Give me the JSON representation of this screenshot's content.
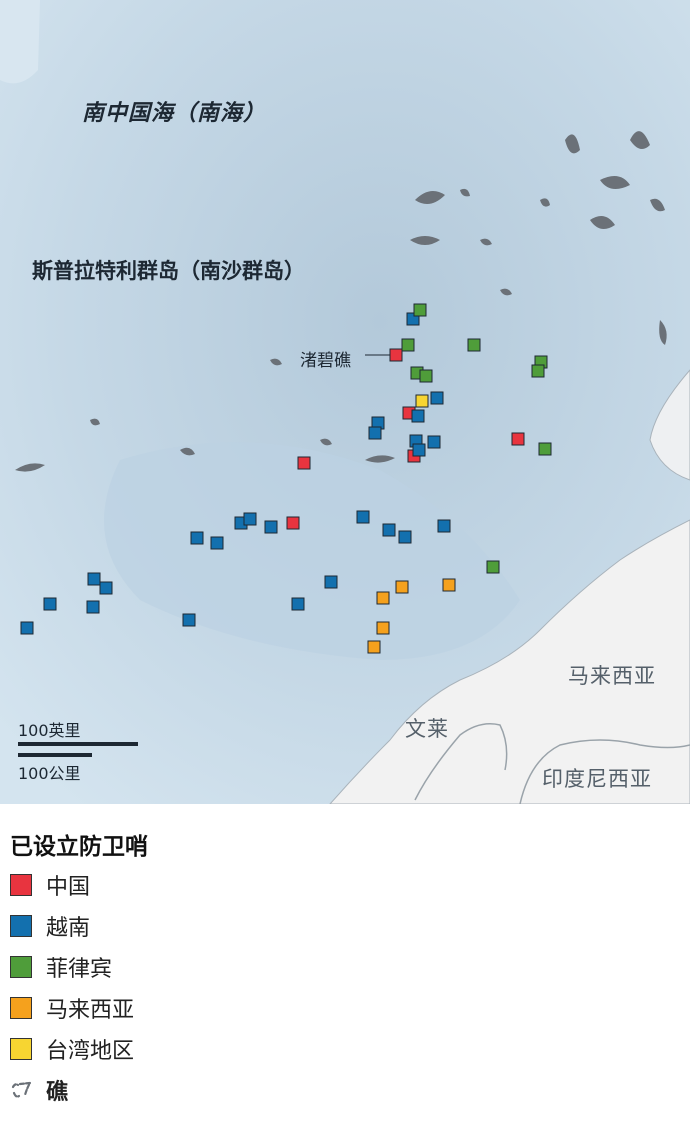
{
  "map": {
    "sea_label": "南中国海（南海）",
    "islands_label": "斯普拉特利群岛（南沙群岛）",
    "reef_callout": "渚碧礁",
    "land_labels": {
      "malaysia": "马来西亚",
      "brunei": "文莱",
      "indonesia": "印度尼西亚"
    },
    "scale": {
      "miles": "100英里",
      "km": "100公里"
    }
  },
  "legend": {
    "title": "已设立防卫哨",
    "items": [
      {
        "key": "china",
        "label": "中国",
        "color": "#e8343f"
      },
      {
        "key": "vietnam",
        "label": "越南",
        "color": "#1370ae"
      },
      {
        "key": "philippines",
        "label": "菲律宾",
        "color": "#4f9d3a"
      },
      {
        "key": "malaysia",
        "label": "马来西亚",
        "color": "#f5a11d"
      },
      {
        "key": "taiwan",
        "label": "台湾地区",
        "color": "#f7d531"
      }
    ],
    "reef_label": "礁"
  },
  "colors": {
    "sea": "#c9dbe8",
    "land": "#f2f2f2",
    "reef": "#6b7178"
  }
}
